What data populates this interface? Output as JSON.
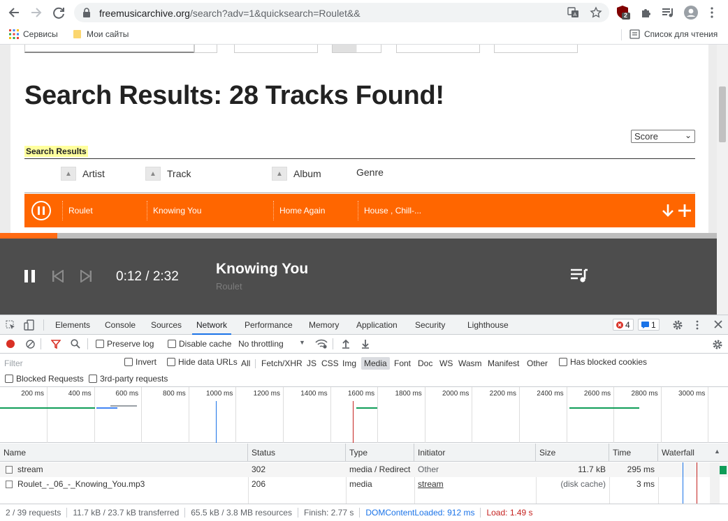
{
  "browser": {
    "url_host": "freemusicarchive.org",
    "url_rest": "/search?adv=1&quicksearch=Roulet&&",
    "bookmarks": [
      {
        "label": "Сервисы"
      },
      {
        "label": "Мои сайты"
      }
    ],
    "reading_list": "Список для чтения",
    "extension_badge": "2"
  },
  "page": {
    "heading": "Search Results: 28 Tracks Found!",
    "sort_value": "Score",
    "results_label": "Search Results",
    "columns": {
      "artist": "Artist",
      "track": "Track",
      "album": "Album",
      "genre": "Genre"
    },
    "track_row": {
      "artist": "Roulet",
      "track": "Knowing You",
      "album": "Home Again",
      "genre": "House , Chill-..."
    }
  },
  "player": {
    "time": "0:12 / 2:32",
    "title": "Knowing You",
    "artist": "Roulet",
    "progress": 0.08
  },
  "devtools": {
    "tabs": [
      "Elements",
      "Console",
      "Sources",
      "Network",
      "Performance",
      "Memory",
      "Application",
      "Security",
      "Lighthouse"
    ],
    "active_tab": "Network",
    "errors": "4",
    "messages": "1",
    "toolbar": {
      "preserve_log": "Preserve log",
      "disable_cache": "Disable cache",
      "throttling": "No throttling"
    },
    "filter": {
      "placeholder": "Filter",
      "invert": "Invert",
      "hide_data_urls": "Hide data URLs",
      "types": [
        "All",
        "Fetch/XHR",
        "JS",
        "CSS",
        "Img",
        "Media",
        "Font",
        "Doc",
        "WS",
        "Wasm",
        "Manifest",
        "Other"
      ],
      "active_type": "Media",
      "blocked_cookies": "Has blocked cookies",
      "blocked_requests": "Blocked Requests",
      "third_party": "3rd-party requests"
    },
    "timeline_ticks": [
      "200 ms",
      "400 ms",
      "600 ms",
      "800 ms",
      "1000 ms",
      "1200 ms",
      "1400 ms",
      "1600 ms",
      "1800 ms",
      "2000 ms",
      "2200 ms",
      "2400 ms",
      "2600 ms",
      "2800 ms",
      "3000 ms"
    ],
    "table": {
      "headers": {
        "name": "Name",
        "status": "Status",
        "type": "Type",
        "initiator": "Initiator",
        "size": "Size",
        "time": "Time",
        "waterfall": "Waterfall"
      },
      "rows": [
        {
          "name": "stream",
          "status": "302",
          "type": "media / Redirect",
          "initiator": "Other",
          "size": "11.7 kB",
          "time": "295 ms"
        },
        {
          "name": "Roulet_-_06_-_Knowing_You.mp3",
          "status": "206",
          "type": "media",
          "initiator": "stream",
          "size": "(disk cache)",
          "time": "3 ms"
        }
      ]
    },
    "status": {
      "requests": "2 / 39 requests",
      "transferred": "11.7 kB / 23.7 kB transferred",
      "resources": "65.5 kB / 3.8 MB resources",
      "finish": "Finish: 2.77 s",
      "domcontentloaded": "DOMContentLoaded: 912 ms",
      "load": "Load: 1.49 s"
    }
  },
  "colors": {
    "accent_orange": "#ff6600",
    "player_bg": "#4d4d4d",
    "devtools_blue": "#1a73e8",
    "load_red": "#c5221f"
  }
}
